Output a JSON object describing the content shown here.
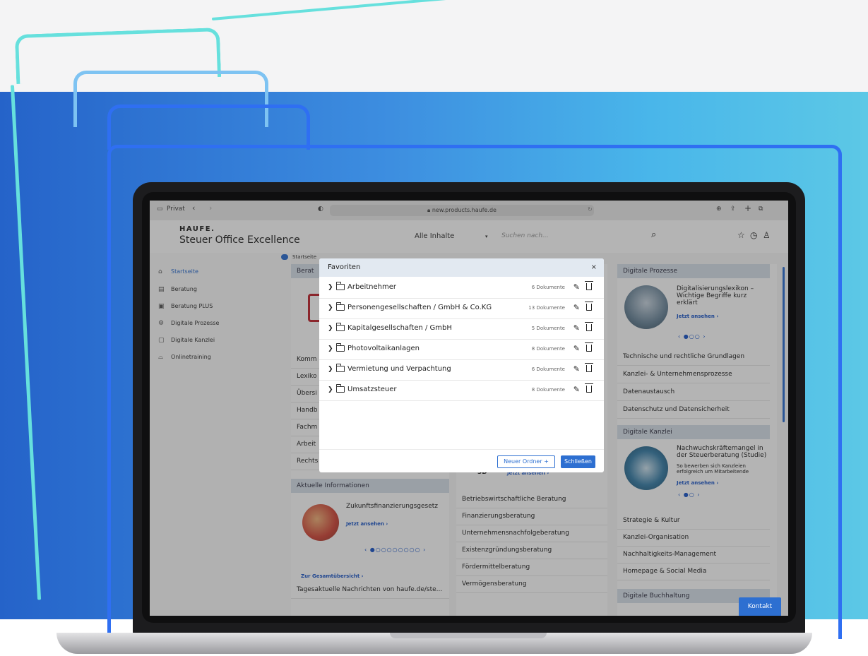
{
  "browser": {
    "profile": "Privat",
    "back_icon": "chevron-left-icon",
    "forward_icon": "chevron-right-icon",
    "url": "new.products.haufe.de"
  },
  "header": {
    "brand": "HAUFE.",
    "product": "Steuer Office Excellence",
    "filter_selected": "Alle Inhalte",
    "search_placeholder": "Suchen nach..."
  },
  "breadcrumb": {
    "label": "Startseite"
  },
  "sidebar": {
    "items": [
      {
        "label": "Startseite",
        "icon": "home-icon"
      },
      {
        "label": "Beratung",
        "icon": "chat-icon"
      },
      {
        "label": "Beratung PLUS",
        "icon": "chat-plus-icon"
      },
      {
        "label": "Digitale Prozesse",
        "icon": "gear-icon"
      },
      {
        "label": "Digitale Kanzlei",
        "icon": "monitor-icon"
      },
      {
        "label": "Onlinetraining",
        "icon": "graduation-cap-icon"
      }
    ]
  },
  "left_panel": {
    "head_partial": "Berat",
    "rows": [
      "Komm",
      "Lexiko",
      "Übersi",
      "Handb",
      "Fachm",
      "Arbeit",
      "Rechts"
    ]
  },
  "aktuelle": {
    "title": "Aktuelle Informationen",
    "teaser": "Zukunftsfinanzierungsgesetz",
    "cta": "Jetzt ansehen",
    "overview": "Zur Gesamtübersicht",
    "news": "Tagesaktuelle Nachrichten von haufe.de/ste..."
  },
  "middle_list": {
    "partial_top": "3D",
    "cta": "Jetzt ansehen",
    "items": [
      "Betriebswirtschaftliche Beratung",
      "Finanzierungsberatung",
      "Unternehmensnachfolgeberatung",
      "Existenzgründungsberatung",
      "Fördermittelberatung",
      "Vermögensberatung"
    ]
  },
  "digitale_prozesse": {
    "title": "Digitale Prozesse",
    "teaser": "Digitalisierungslexikon – Wichtige Begriffe kurz erklärt",
    "cta": "Jetzt ansehen",
    "items": [
      "Technische und rechtliche Grundlagen",
      "Kanzlei- & Unternehmensprozesse",
      "Datenaustausch",
      "Datenschutz und Datensicherheit"
    ]
  },
  "digitale_kanzlei": {
    "title": "Digitale Kanzlei",
    "teaser": "Nachwuchskräftemangel in der Steuerberatung (Studie)",
    "subtext": "So bewerben sich Kanzleien erfolgreich um Mitarbeitende",
    "cta": "Jetzt ansehen",
    "items": [
      "Strategie & Kultur",
      "Kanzlei-Organisation",
      "Nachhaltigkeits-Management",
      "Homepage & Social Media"
    ]
  },
  "digitale_buchhaltung": {
    "title": "Digitale Buchhaltung"
  },
  "modal": {
    "title": "Favoriten",
    "close": "×",
    "folders": [
      {
        "name": "Arbeitnehmer",
        "count": "6 Dokumente"
      },
      {
        "name": "Personengesellschaften / GmbH & Co.KG",
        "count": "13 Dokumente"
      },
      {
        "name": "Kapitalgesellschaften / GmbH",
        "count": "5 Dokumente"
      },
      {
        "name": "Photovoltaikanlagen",
        "count": "8 Dokumente"
      },
      {
        "name": "Vermietung und Verpachtung",
        "count": "6 Dokumente"
      },
      {
        "name": "Umsatzsteuer",
        "count": "8 Dokumente"
      }
    ],
    "new_folder_button": "Neuer Ordner",
    "close_button": "Schließen"
  },
  "kontakt_button": "Kontakt",
  "colors": {
    "accent": "#2d6fd1",
    "frame_cyan": "#66e0dd",
    "frame_blue_light": "#5aa8f0",
    "frame_blue": "#2f6ff2"
  }
}
